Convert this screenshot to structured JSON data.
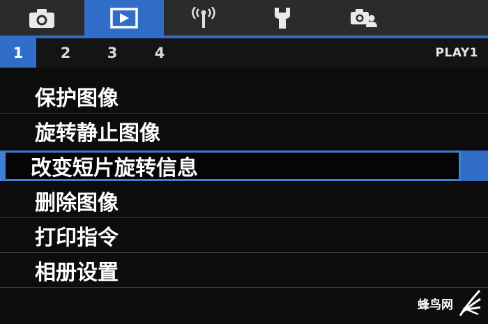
{
  "tabs": [
    {
      "icon": "camera-icon",
      "active": false
    },
    {
      "icon": "play-icon",
      "active": true
    },
    {
      "icon": "wireless-icon",
      "active": false
    },
    {
      "icon": "wrench-icon",
      "active": false
    },
    {
      "icon": "custom-camera-icon",
      "active": false
    }
  ],
  "pages": {
    "items": [
      "1",
      "2",
      "3",
      "4"
    ],
    "active": "1",
    "label": "PLAY1"
  },
  "menu": {
    "items": [
      {
        "label": "保护图像"
      },
      {
        "label": "旋转静止图像"
      },
      {
        "label": "改变短片旋转信息",
        "selected": true
      },
      {
        "label": "删除图像"
      },
      {
        "label": "打印指令"
      },
      {
        "label": "相册设置"
      }
    ]
  },
  "watermark": {
    "text": "蜂鸟网"
  },
  "colors": {
    "accent": "#2f6dc9",
    "background": "#0d0d0d"
  }
}
